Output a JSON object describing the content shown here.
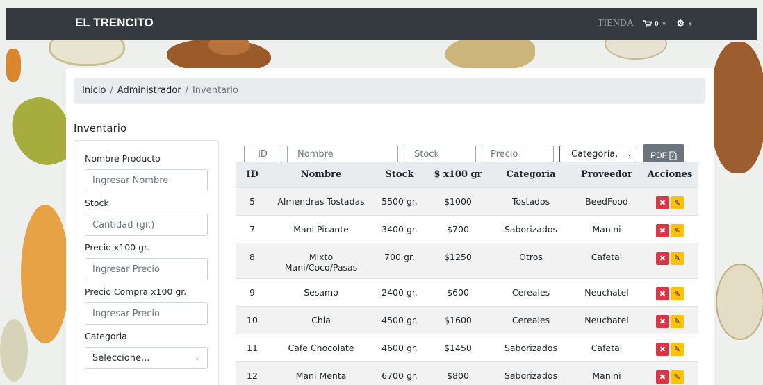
{
  "navbar": {
    "brand": "EL TRENCITO",
    "tienda": "TIENDA",
    "cart_count": "0",
    "cart_icon": "cart-icon",
    "settings_icon": "gear-icon"
  },
  "breadcrumb": {
    "home": "Inicio",
    "admin": "Administrador",
    "current": "Inventario"
  },
  "page_title": "Inventario",
  "form": {
    "nombre_label": "Nombre Producto",
    "nombre_placeholder": "Ingresar Nombre",
    "stock_label": "Stock",
    "stock_placeholder": "Cantidad (gr.)",
    "precio_label": "Precio x100 gr.",
    "precio_placeholder": "Ingresar Precio",
    "compra_label": "Precio Compra x100 gr.",
    "compra_placeholder": "Ingresar Precio",
    "categoria_label": "Categoria",
    "categoria_value": "Seleccione..."
  },
  "filters": {
    "id": "ID",
    "nombre": "Nombre",
    "stock": "Stock",
    "precio": "Precio",
    "categoria": "Categoria.",
    "pdf": "PDF"
  },
  "table": {
    "headers": [
      "ID",
      "Nombre",
      "Stock",
      "$ x100 gr",
      "Categoria",
      "Proveedor",
      "Acciones"
    ],
    "rows": [
      {
        "id": "5",
        "nombre": "Almendras Tostadas",
        "stock": "5500 gr.",
        "precio": "$1000",
        "categoria": "Tostados",
        "proveedor": "BeedFood"
      },
      {
        "id": "7",
        "nombre": "Mani Picante",
        "stock": "3400 gr.",
        "precio": "$700",
        "categoria": "Saborizados",
        "proveedor": "Manini"
      },
      {
        "id": "8",
        "nombre": "Mixto Mani/Coco/Pasas",
        "stock": "700 gr.",
        "precio": "$1250",
        "categoria": "Otros",
        "proveedor": "Cafetal"
      },
      {
        "id": "9",
        "nombre": "Sesamo",
        "stock": "2400 gr.",
        "precio": "$600",
        "categoria": "Cereales",
        "proveedor": "Neuchatel"
      },
      {
        "id": "10",
        "nombre": "Chia",
        "stock": "4500 gr.",
        "precio": "$1600",
        "categoria": "Cereales",
        "proveedor": "Neuchatel"
      },
      {
        "id": "11",
        "nombre": "Cafe Chocolate",
        "stock": "4600 gr.",
        "precio": "$1450",
        "categoria": "Saborizados",
        "proveedor": "Cafetal"
      },
      {
        "id": "12",
        "nombre": "Mani Menta",
        "stock": "6700 gr.",
        "precio": "$800",
        "categoria": "Saborizados",
        "proveedor": "Manini"
      }
    ]
  },
  "colors": {
    "navbar": "#343a40",
    "delete": "#dc3545",
    "edit": "#ffc107",
    "pdf_button": "#6c757d"
  }
}
